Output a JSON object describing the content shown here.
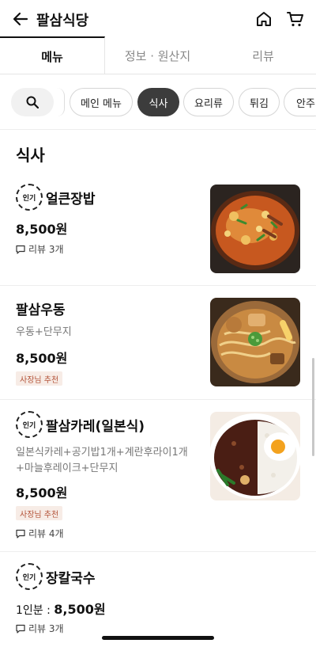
{
  "header": {
    "title": "팔삼식당"
  },
  "tabs": [
    {
      "label": "메뉴"
    },
    {
      "label": "정보 · 원산지"
    },
    {
      "label": "리뷰"
    }
  ],
  "chips": [
    {
      "label": "메인 메뉴"
    },
    {
      "label": "식사"
    },
    {
      "label": "요리류"
    },
    {
      "label": "튀김"
    },
    {
      "label": "안주"
    }
  ],
  "section": {
    "title": "식사"
  },
  "badges": {
    "popular": "인기",
    "owner": "사장님 추천"
  },
  "items": [
    {
      "name": "얼큰장밥",
      "price": "8,500원",
      "review": "리뷰 3개"
    },
    {
      "name": "팔삼우동",
      "desc": "우동+단무지",
      "price": "8,500원"
    },
    {
      "name": "팔삼카레(일본식)",
      "desc": "일본식카레+공기밥1개+계란후라이1개+마늘후레이크+단무지",
      "price": "8,500원",
      "review": "리뷰 4개"
    },
    {
      "name": "장칼국수",
      "price_prefix": "1인분 : ",
      "price": "8,500원",
      "review": "리뷰 3개"
    }
  ],
  "colors": {
    "accent_dark": "#3c3c3c",
    "owner_badge_bg": "#f7ece6",
    "owner_badge_text": "#b4543a"
  }
}
